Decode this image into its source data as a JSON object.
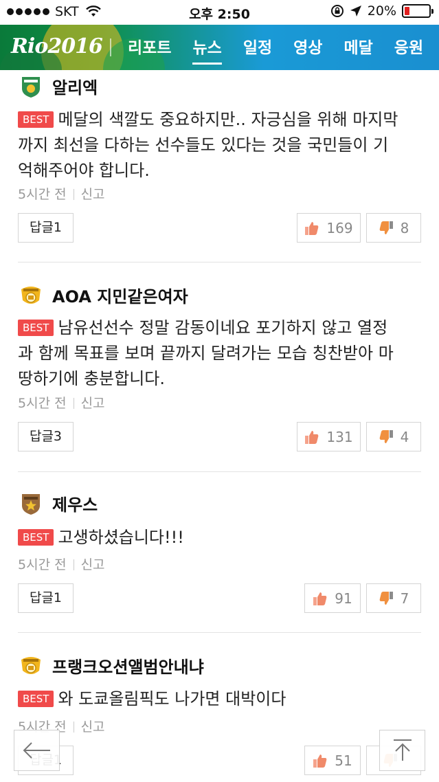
{
  "status_bar": {
    "carrier": "SKT",
    "time": "오후 2:50",
    "battery": "20%",
    "battery_level": 0.2
  },
  "nav": {
    "logo": "Rio2016",
    "tabs": [
      {
        "label": "리포트",
        "active": false
      },
      {
        "label": "뉴스",
        "active": true
      },
      {
        "label": "일정",
        "active": false
      },
      {
        "label": "영상",
        "active": false
      },
      {
        "label": "메달",
        "active": false
      },
      {
        "label": "응원",
        "active": false
      }
    ]
  },
  "best_label": "BEST",
  "report_label": "신고",
  "comments": [
    {
      "author": "알리엑",
      "badge": "amateur-badge-icon",
      "text": "메달의 색깔도 중요하지만.. 자긍심을 위해 마지막까지 최선을 다하는 선수들도 있다는 것을 국민들이 기억해주어야 합니다.",
      "text_lines": [
        "메달의 색깔도 중요하지만.. 자긍심을 위해 마지막",
        "까지 최선을 다하는 선수들도 있다는 것을 국민들이 기",
        "억해주어야 합니다."
      ],
      "time": "5시간 전",
      "reply": "답글1",
      "likes": "169",
      "dislikes": "8"
    },
    {
      "author": "AOA 지민같은여자",
      "badge": "master-badge-icon",
      "text": "남유선선수 정말 감동이네요 포기하지 않고 열정과 함께 목표를 보며 끝까지 달려가는 모습 칭찬받아 마땅하기에 충분합니다.",
      "text_lines": [
        "남유선선수 정말 감동이네요 포기하지 않고 열정",
        "과 함께 목표를 보며 끝까지 달려가는 모습 칭찬받아 마",
        "땅하기에 충분합니다."
      ],
      "time": "5시간 전",
      "reply": "답글3",
      "likes": "131",
      "dislikes": "4"
    },
    {
      "author": "제우스",
      "badge": "senior-badge-icon",
      "text": "고생하셨습니다!!!",
      "text_lines": [
        "고생하셨습니다!!!"
      ],
      "time": "5시간 전",
      "reply": "답글1",
      "likes": "91",
      "dislikes": "7"
    },
    {
      "author": "프랭크오션앨범안내냐",
      "badge": "master-badge-icon",
      "text": "와 도쿄올림픽도 나가면 대박이다",
      "text_lines": [
        "와 도쿄올림픽도 나가면 대박이다"
      ],
      "time": "5시간 전",
      "reply": "답글1",
      "likes": "51",
      "dislikes": ""
    }
  ],
  "colors": {
    "best": "#f04a4a",
    "nav_green": "#0e8f46",
    "nav_blue": "#1a9ad6",
    "like": "#f08a6a",
    "dislike": "#f09040"
  }
}
